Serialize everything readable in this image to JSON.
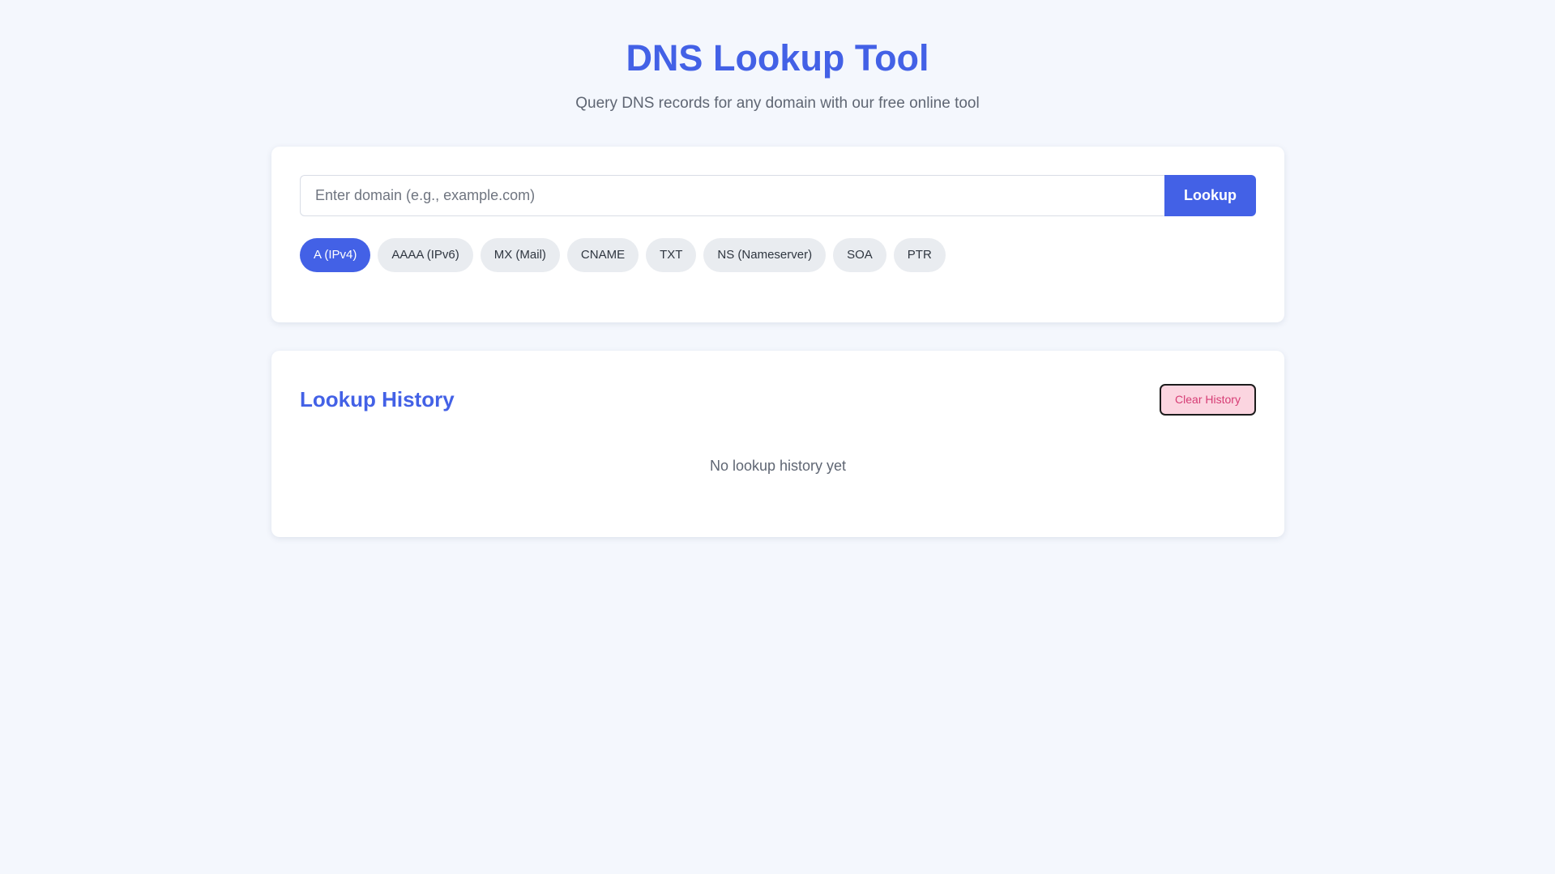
{
  "header": {
    "title": "DNS Lookup Tool",
    "subtitle": "Query DNS records for any domain with our free online tool"
  },
  "search": {
    "placeholder": "Enter domain (e.g., example.com)",
    "value": "",
    "button_label": "Lookup"
  },
  "record_types": {
    "selected": "A (IPv4)",
    "items": [
      {
        "label": "A (IPv4)"
      },
      {
        "label": "AAAA (IPv6)"
      },
      {
        "label": "MX (Mail)"
      },
      {
        "label": "CNAME"
      },
      {
        "label": "TXT"
      },
      {
        "label": "NS (Nameserver)"
      },
      {
        "label": "SOA"
      },
      {
        "label": "PTR"
      }
    ]
  },
  "history": {
    "title": "Lookup History",
    "clear_label": "Clear History",
    "empty_message": "No lookup history yet"
  },
  "colors": {
    "accent": "#4361e6",
    "background": "#f4f7fd",
    "chip_bg": "#e9ecf0",
    "danger_text": "#d63c74",
    "danger_bg": "#fbd5e0"
  }
}
